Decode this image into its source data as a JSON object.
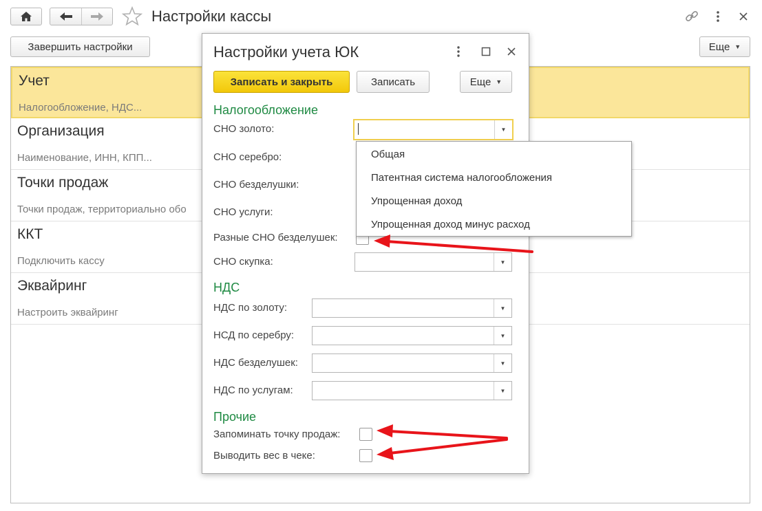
{
  "window": {
    "title": "Настройки кассы",
    "finish_label": "Завершить настройки",
    "more_label": "Еще"
  },
  "sections_list": [
    {
      "title": "Учет",
      "subtitle": "Налогообложение, НДС..."
    },
    {
      "title": "Организация",
      "subtitle": "Наименование, ИНН, КПП..."
    },
    {
      "title": "Точки продаж",
      "subtitle": "Точки продаж, территориально обо"
    },
    {
      "title": "ККТ",
      "subtitle": "Подключить кассу"
    },
    {
      "title": "Эквайринг",
      "subtitle": "Настроить эквайринг"
    }
  ],
  "dialog": {
    "title": "Настройки учета ЮК",
    "save_close_label": "Записать и закрыть",
    "save_label": "Записать",
    "more_label": "Еще",
    "tax_section": "Налогообложение",
    "fields": {
      "sno_gold": "СНО золото:",
      "sno_silver": "СНО серебро:",
      "sno_trinkets": "СНО безделушки:",
      "sno_services": "СНО услуги:",
      "diff_sno_trinkets": "Разные СНО безделушек:",
      "sno_buyback": "СНО скупка:"
    },
    "vat_section": "НДС",
    "vat_fields": {
      "vat_gold": "НДС по золоту:",
      "vat_silver": "НСД по серебру:",
      "vat_trinkets": "НДС безделушек:",
      "vat_services": "НДС по услугам:"
    },
    "other_section": "Прочие",
    "other_fields": {
      "remember_point": "Запоминать точку продаж:",
      "print_weight": "Выводить вес в чеке:"
    },
    "dropdown_options": [
      "Общая",
      "Патентная система налогообложения",
      "Упрощенная доход",
      "Упрощенная доход минус расход"
    ]
  },
  "colors": {
    "accent_yellow": "#f2c80a",
    "selection": "#fbe69a",
    "section_green": "#1f8a43",
    "annotation_red": "#e8141a"
  }
}
